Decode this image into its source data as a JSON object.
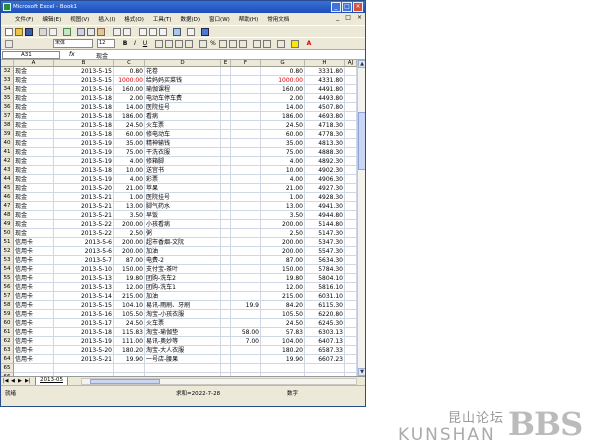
{
  "window": {
    "title": "Microsoft Excel - Book1"
  },
  "menu": {
    "items": [
      "文件(F)",
      "编辑(E)",
      "视图(V)",
      "插入(I)",
      "格式(O)",
      "工具(T)",
      "数据(D)",
      "窗口(W)",
      "帮助(H)",
      "常用文档"
    ],
    "window_controls": [
      "_",
      "□",
      "×"
    ]
  },
  "toolbar": {
    "font_name": "宋体",
    "font_size": "12"
  },
  "formula_bar": {
    "cell_ref": "A31",
    "fx_label": "fx",
    "content": "现金"
  },
  "columns": [
    "A",
    "B",
    "C",
    "D",
    "E",
    "F",
    "G",
    "H",
    "AJ"
  ],
  "rows": [
    {
      "n": "32",
      "a": "现金",
      "b": "2013-5-15",
      "c": "0.80",
      "d": "花卷",
      "f": "",
      "g": "0.80",
      "h": "3331.80"
    },
    {
      "n": "33",
      "a": "现金",
      "b": "2013-5-15",
      "c": "1000.00",
      "d": "给妈妈买菜钱",
      "f": "",
      "g": "1000.00",
      "h": "4331.80",
      "red": true
    },
    {
      "n": "34",
      "a": "现金",
      "b": "2013-5-16",
      "c": "160.00",
      "d": "瑜伽课程",
      "f": "",
      "g": "160.00",
      "h": "4491.80"
    },
    {
      "n": "35",
      "a": "现金",
      "b": "2013-5-18",
      "c": "2.00",
      "d": "电动车停车费",
      "f": "",
      "g": "2.00",
      "h": "4493.80"
    },
    {
      "n": "36",
      "a": "现金",
      "b": "2013-5-18",
      "c": "14.00",
      "d": "医院挂号",
      "f": "",
      "g": "14.00",
      "h": "4507.80"
    },
    {
      "n": "37",
      "a": "现金",
      "b": "2013-5-18",
      "c": "186.00",
      "d": "看病",
      "f": "",
      "g": "186.00",
      "h": "4693.80"
    },
    {
      "n": "38",
      "a": "现金",
      "b": "2013-5-18",
      "c": "24.50",
      "d": "火车票",
      "f": "",
      "g": "24.50",
      "h": "4718.30"
    },
    {
      "n": "39",
      "a": "现金",
      "b": "2013-5-18",
      "c": "60.00",
      "d": "修电动车",
      "f": "",
      "g": "60.00",
      "h": "4778.30"
    },
    {
      "n": "40",
      "a": "现金",
      "b": "2013-5-19",
      "c": "35.00",
      "d": "精神输钱",
      "f": "",
      "g": "35.00",
      "h": "4813.30"
    },
    {
      "n": "41",
      "a": "现金",
      "b": "2013-5-19",
      "c": "75.00",
      "d": "干洗衣服",
      "f": "",
      "g": "75.00",
      "h": "4888.30"
    },
    {
      "n": "42",
      "a": "现金",
      "b": "2013-5-19",
      "c": "4.00",
      "d": "修箱脚",
      "f": "",
      "g": "4.00",
      "h": "4892.30"
    },
    {
      "n": "43",
      "a": "现金",
      "b": "2013-5-18",
      "c": "10.00",
      "d": "送宫书",
      "f": "",
      "g": "10.00",
      "h": "4902.30"
    },
    {
      "n": "44",
      "a": "现金",
      "b": "2013-5-19",
      "c": "4.00",
      "d": "彩票",
      "f": "",
      "g": "4.00",
      "h": "4906.30"
    },
    {
      "n": "45",
      "a": "现金",
      "b": "2013-5-20",
      "c": "21.00",
      "d": "苹果",
      "f": "",
      "g": "21.00",
      "h": "4927.30"
    },
    {
      "n": "46",
      "a": "现金",
      "b": "2013-5-21",
      "c": "1.00",
      "d": "医院挂号",
      "f": "",
      "g": "1.00",
      "h": "4928.30"
    },
    {
      "n": "47",
      "a": "现金",
      "b": "2013-5-21",
      "c": "13.00",
      "d": "脚气药水",
      "f": "",
      "g": "13.00",
      "h": "4941.30"
    },
    {
      "n": "48",
      "a": "现金",
      "b": "2013-5-21",
      "c": "3.50",
      "d": "早饭",
      "f": "",
      "g": "3.50",
      "h": "4944.80"
    },
    {
      "n": "49",
      "a": "现金",
      "b": "2013-5-22",
      "c": "200.00",
      "d": "小孩看病",
      "f": "",
      "g": "200.00",
      "h": "5144.80"
    },
    {
      "n": "50",
      "a": "现金",
      "b": "2013-5-22",
      "c": "2.50",
      "d": "粥",
      "f": "",
      "g": "2.50",
      "h": "5147.30"
    },
    {
      "n": "51",
      "a": "信用卡",
      "b": "2013-5-6",
      "c": "200.00",
      "d": "超市香烟-文阮",
      "f": "",
      "g": "200.00",
      "h": "5347.30"
    },
    {
      "n": "52",
      "a": "信用卡",
      "b": "2013-5-6",
      "c": "200.00",
      "d": "加油",
      "f": "",
      "g": "200.00",
      "h": "5547.30"
    },
    {
      "n": "53",
      "a": "信用卡",
      "b": "2013-5-7",
      "c": "87.00",
      "d": "电费-2",
      "f": "",
      "g": "87.00",
      "h": "5634.30"
    },
    {
      "n": "54",
      "a": "信用卡",
      "b": "2013-5-10",
      "c": "150.00",
      "d": "支付宝-茶叶",
      "f": "",
      "g": "150.00",
      "h": "5784.30"
    },
    {
      "n": "55",
      "a": "信用卡",
      "b": "2013-5-13",
      "c": "19.80",
      "d": "团购-洗车2",
      "f": "",
      "g": "19.80",
      "h": "5804.10"
    },
    {
      "n": "56",
      "a": "信用卡",
      "b": "2013-5-13",
      "c": "12.00",
      "d": "团购-洗车1",
      "f": "",
      "g": "12.00",
      "h": "5816.10"
    },
    {
      "n": "57",
      "a": "信用卡",
      "b": "2013-5-14",
      "c": "215.00",
      "d": "加油",
      "f": "",
      "g": "215.00",
      "h": "6031.10"
    },
    {
      "n": "58",
      "a": "信用卡",
      "b": "2013-5-15",
      "c": "104.10",
      "d": "易讯-雨刷、牙刷",
      "f": "19.9",
      "g": "84.20",
      "h": "6115.30"
    },
    {
      "n": "59",
      "a": "信用卡",
      "b": "2013-5-16",
      "c": "105.50",
      "d": "淘宝-小孩衣服",
      "f": "",
      "g": "105.50",
      "h": "6220.80"
    },
    {
      "n": "60",
      "a": "信用卡",
      "b": "2013-5-17",
      "c": "24.50",
      "d": "火车票",
      "f": "",
      "g": "24.50",
      "h": "6245.30"
    },
    {
      "n": "61",
      "a": "信用卡",
      "b": "2013-5-18",
      "c": "115.83",
      "d": "淘宝-瑜伽垫",
      "f": "58.00",
      "g": "57.83",
      "h": "6303.13"
    },
    {
      "n": "62",
      "a": "信用卡",
      "b": "2013-5-19",
      "c": "111.00",
      "d": "易讯-奥妙等",
      "f": "7.00",
      "g": "104.00",
      "h": "6407.13"
    },
    {
      "n": "63",
      "a": "信用卡",
      "b": "2013-5-20",
      "c": "180.20",
      "d": "淘宝-大人衣服",
      "f": "",
      "g": "180.20",
      "h": "6587.33"
    },
    {
      "n": "64",
      "a": "信用卡",
      "b": "2013-5-21",
      "c": "19.90",
      "d": "一号店-腰果",
      "f": "",
      "g": "19.90",
      "h": "6607.23"
    },
    {
      "n": "65",
      "a": "",
      "b": "",
      "c": "",
      "d": "",
      "f": "",
      "g": "",
      "h": ""
    },
    {
      "n": "66",
      "a": "",
      "b": "",
      "c": "",
      "d": "",
      "f": "",
      "g": "",
      "h": ""
    },
    {
      "n": "67",
      "a": "",
      "b": "",
      "c": "",
      "d": "",
      "f": "",
      "g": "",
      "h": ""
    }
  ],
  "sheet_tabs": {
    "nav": [
      "|◀",
      "◀",
      "▶",
      "▶|"
    ],
    "active": "2013-05"
  },
  "status": {
    "left": "就绪",
    "sum": "求和=2022-7-28",
    "mode": "数字"
  },
  "watermark": {
    "top": "昆山论坛",
    "bottom": "KUNSHAN",
    "big": "BBS"
  }
}
